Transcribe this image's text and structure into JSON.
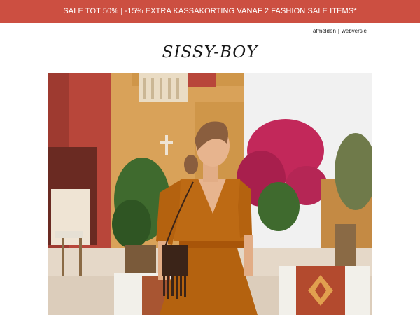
{
  "banner": {
    "text": "SALE TOT 50% | -15% EXTRA KASSAKORTING VANAF 2 FASHION SALE ITEMS*",
    "bg_color": "#cc4f41"
  },
  "toplinks": {
    "unsubscribe": "afmelden",
    "separator": "|",
    "webversion": "webversie"
  },
  "logo": {
    "text": "SISSY-BOY"
  },
  "hero": {
    "icon": "hero-photo",
    "colors": {
      "sky": "#f3f3f3",
      "wall_red": "#b8463a",
      "wall_ochre": "#d9a259",
      "bougainvillea": "#c2285a",
      "dress": "#b4620f",
      "leaves": "#3f6a2e"
    }
  }
}
